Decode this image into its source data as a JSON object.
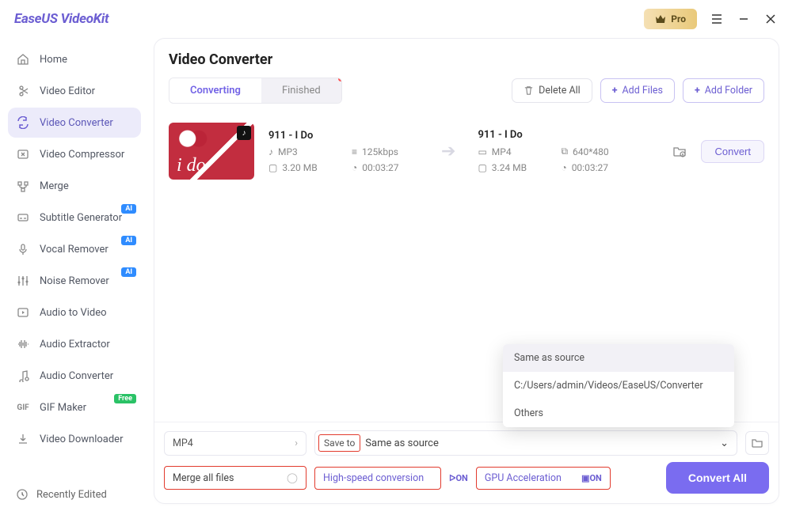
{
  "brand": "EaseUS VideoKit",
  "titlebar": {
    "pro": "Pro"
  },
  "sidebar": {
    "items": [
      {
        "label": "Home"
      },
      {
        "label": "Video Editor"
      },
      {
        "label": "Video Converter"
      },
      {
        "label": "Video Compressor"
      },
      {
        "label": "Merge"
      },
      {
        "label": "Subtitle Generator",
        "badge": "AI"
      },
      {
        "label": "Vocal Remover",
        "badge": "AI"
      },
      {
        "label": "Noise Remover",
        "badge": "AI"
      },
      {
        "label": "Audio to Video"
      },
      {
        "label": "Audio Extractor"
      },
      {
        "label": "Audio Converter"
      },
      {
        "label": "GIF Maker",
        "badge": "Free"
      },
      {
        "label": "Video Downloader"
      }
    ],
    "bottom": "Recently Edited"
  },
  "page": {
    "title": "Video Converter",
    "tabs": {
      "converting": "Converting",
      "finished": "Finished"
    },
    "actions": {
      "delete_all": "Delete All",
      "add_files": "Add Files",
      "add_folder": "Add Folder"
    }
  },
  "item": {
    "src": {
      "title": "911 - I Do",
      "format": "MP3",
      "bitrate": "125kbps",
      "size": "3.20 MB",
      "duration": "00:03:27",
      "thumb_text": "i do"
    },
    "dst": {
      "title": "911 - I Do",
      "format": "MP4",
      "resolution": "640*480",
      "size": "3.24 MB",
      "duration": "00:03:27"
    },
    "convert": "Convert"
  },
  "popup": {
    "opt1": "Same as source",
    "opt2": "C:/Users/admin/Videos/EaseUS/Converter",
    "opt3": "Others"
  },
  "bottom": {
    "output_format": "MP4",
    "save_to_label": "Save to",
    "save_to_value": "Same as source",
    "merge": "Merge all files",
    "high_speed": "High-speed conversion",
    "gpu": "GPU Acceleration",
    "convert_all": "Convert All"
  }
}
